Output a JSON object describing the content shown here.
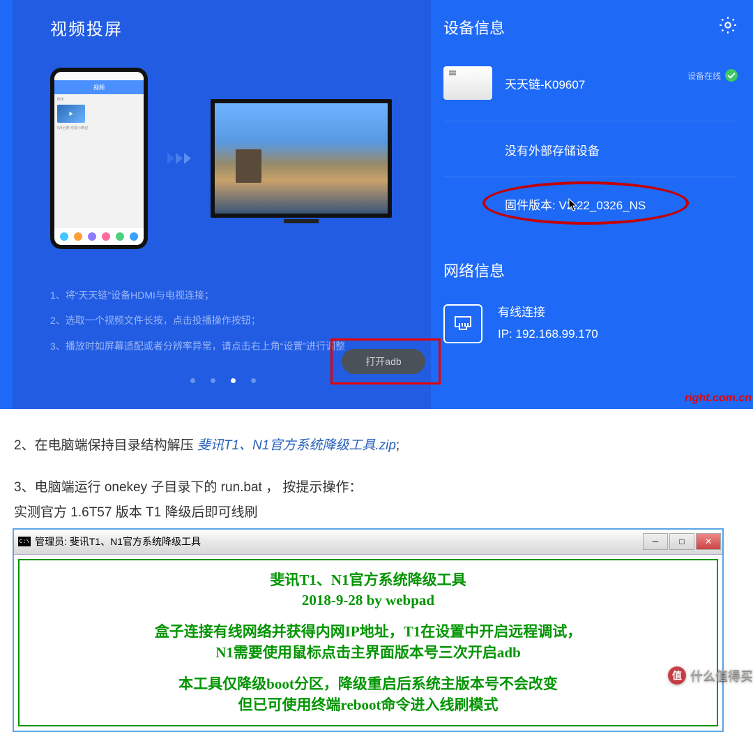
{
  "nav": {
    "cast_title": "视频投屏",
    "instructions": [
      "1、将“天天链”设备HDMI与电视连接；",
      "2、选取一个视频文件长按，点击投播操作按钮；",
      "3、播放时如屏幕适配或者分辨率异常，请点击右上角“设置”进行调整"
    ],
    "phone_header": "视频",
    "phone_label": "昨天",
    "phone_sub": "5月分类    可爱小表记",
    "active_dot": 2,
    "adb_button": "打开adb"
  },
  "device_info": {
    "title": "设备信息",
    "name": "天天链-K09607",
    "status": "设备在线",
    "storage": "没有外部存储设备",
    "firmware": "固件版本: V2.22_0326_NS"
  },
  "network": {
    "title": "网络信息",
    "type": "有线连接",
    "ip": "IP: 192.168.99.170"
  },
  "watermark": "right.com.cn",
  "article": {
    "step2_prefix": "2、在电脑端保持目录结构解压 ",
    "step2_link": "斐讯T1、N1官方系统降级工具.zip",
    "step2_suffix": ";",
    "step3": "3、电脑端运行 onekey 子目录下的 run.bat ， 按提示操作：",
    "step3b": "实测官方 1.6T57 版本 T1  降级后即可线刷"
  },
  "cmd": {
    "title": "管理员: 斐讯T1、N1官方系统降级工具",
    "line1": "斐讯T1、N1官方系统降级工具",
    "line2": "2018-9-28   by webpad",
    "line3": "盒子连接有线网络并获得内网IP地址，T1在设置中开启远程调试，",
    "line4": "N1需要使用鼠标点击主界面版本号三次开启adb",
    "line5": "本工具仅降级boot分区，降级重启后系统主版本号不会改变",
    "line6": "但已可使用终端reboot命令进入线刷模式"
  },
  "worth": "什么值得买"
}
